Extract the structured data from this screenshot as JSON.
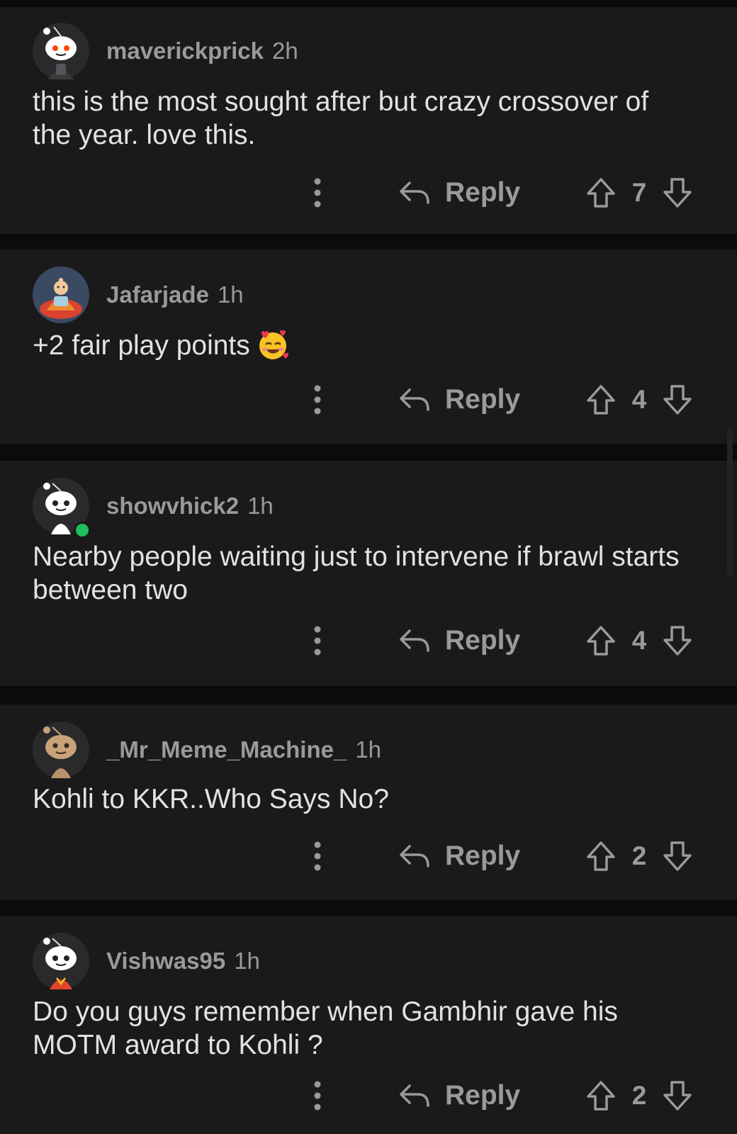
{
  "comments": [
    {
      "username": "maverickprick",
      "time": "2h",
      "text": "this is the most sought after but crazy crossover of the year. love this.",
      "reply_label": "Reply",
      "score": "7",
      "avatar": "snoo-avatar-default",
      "online": false
    },
    {
      "username": "Jafarjade",
      "time": "1h",
      "text": "+2 fair play points",
      "emoji": "smiling-face-with-hearts",
      "reply_label": "Reply",
      "score": "4",
      "avatar": "monk-avatar",
      "online": false
    },
    {
      "username": "showvhick2",
      "time": "1h",
      "text": "Nearby people waiting just to intervene if brawl starts between two",
      "reply_label": "Reply",
      "score": "4",
      "avatar": "snoo-avatar-white",
      "online": true
    },
    {
      "username": "_Mr_Meme_Machine_",
      "time": "1h",
      "text": "Kohli to KKR..Who Says No?",
      "reply_label": "Reply",
      "score": "2",
      "avatar": "snoo-avatar-tan",
      "online": false
    },
    {
      "username": "Vishwas95",
      "time": "1h",
      "text": "Do you guys remember when Gambhir gave his MOTM award to Kohli ?",
      "reply_label": "Reply",
      "score": "2",
      "avatar": "snoo-avatar-orange-shirt",
      "online": false
    }
  ],
  "colors": {
    "background": "#0b0b0c",
    "card": "#1a1a1b",
    "text": "#e2e2e4",
    "meta": "#9a9a9c",
    "online": "#1fbf5c"
  }
}
